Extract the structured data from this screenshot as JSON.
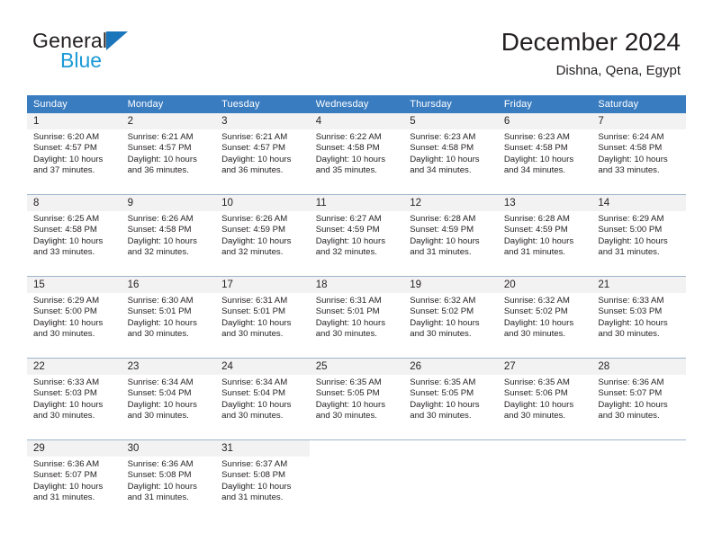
{
  "brand": {
    "name_part1": "General",
    "name_part2": "Blue",
    "triangle_color": "#1b75bb",
    "blue_text_color": "#1b9ad6"
  },
  "header": {
    "title": "December 2024",
    "subtitle": "Dishna, Qena, Egypt"
  },
  "theme": {
    "header_bg": "#3a7cc0",
    "header_text": "#ffffff",
    "daynum_band_bg": "#f2f2f2",
    "cell_border": "#9fb6cd",
    "text": "#231f20"
  },
  "weekday_headers": [
    "Sunday",
    "Monday",
    "Tuesday",
    "Wednesday",
    "Thursday",
    "Friday",
    "Saturday"
  ],
  "weeks": [
    [
      {
        "day": "1",
        "sunrise": "Sunrise: 6:20 AM",
        "sunset": "Sunset: 4:57 PM",
        "daylight1": "Daylight: 10 hours",
        "daylight2": "and 37 minutes."
      },
      {
        "day": "2",
        "sunrise": "Sunrise: 6:21 AM",
        "sunset": "Sunset: 4:57 PM",
        "daylight1": "Daylight: 10 hours",
        "daylight2": "and 36 minutes."
      },
      {
        "day": "3",
        "sunrise": "Sunrise: 6:21 AM",
        "sunset": "Sunset: 4:57 PM",
        "daylight1": "Daylight: 10 hours",
        "daylight2": "and 36 minutes."
      },
      {
        "day": "4",
        "sunrise": "Sunrise: 6:22 AM",
        "sunset": "Sunset: 4:58 PM",
        "daylight1": "Daylight: 10 hours",
        "daylight2": "and 35 minutes."
      },
      {
        "day": "5",
        "sunrise": "Sunrise: 6:23 AM",
        "sunset": "Sunset: 4:58 PM",
        "daylight1": "Daylight: 10 hours",
        "daylight2": "and 34 minutes."
      },
      {
        "day": "6",
        "sunrise": "Sunrise: 6:23 AM",
        "sunset": "Sunset: 4:58 PM",
        "daylight1": "Daylight: 10 hours",
        "daylight2": "and 34 minutes."
      },
      {
        "day": "7",
        "sunrise": "Sunrise: 6:24 AM",
        "sunset": "Sunset: 4:58 PM",
        "daylight1": "Daylight: 10 hours",
        "daylight2": "and 33 minutes."
      }
    ],
    [
      {
        "day": "8",
        "sunrise": "Sunrise: 6:25 AM",
        "sunset": "Sunset: 4:58 PM",
        "daylight1": "Daylight: 10 hours",
        "daylight2": "and 33 minutes."
      },
      {
        "day": "9",
        "sunrise": "Sunrise: 6:26 AM",
        "sunset": "Sunset: 4:58 PM",
        "daylight1": "Daylight: 10 hours",
        "daylight2": "and 32 minutes."
      },
      {
        "day": "10",
        "sunrise": "Sunrise: 6:26 AM",
        "sunset": "Sunset: 4:59 PM",
        "daylight1": "Daylight: 10 hours",
        "daylight2": "and 32 minutes."
      },
      {
        "day": "11",
        "sunrise": "Sunrise: 6:27 AM",
        "sunset": "Sunset: 4:59 PM",
        "daylight1": "Daylight: 10 hours",
        "daylight2": "and 32 minutes."
      },
      {
        "day": "12",
        "sunrise": "Sunrise: 6:28 AM",
        "sunset": "Sunset: 4:59 PM",
        "daylight1": "Daylight: 10 hours",
        "daylight2": "and 31 minutes."
      },
      {
        "day": "13",
        "sunrise": "Sunrise: 6:28 AM",
        "sunset": "Sunset: 4:59 PM",
        "daylight1": "Daylight: 10 hours",
        "daylight2": "and 31 minutes."
      },
      {
        "day": "14",
        "sunrise": "Sunrise: 6:29 AM",
        "sunset": "Sunset: 5:00 PM",
        "daylight1": "Daylight: 10 hours",
        "daylight2": "and 31 minutes."
      }
    ],
    [
      {
        "day": "15",
        "sunrise": "Sunrise: 6:29 AM",
        "sunset": "Sunset: 5:00 PM",
        "daylight1": "Daylight: 10 hours",
        "daylight2": "and 30 minutes."
      },
      {
        "day": "16",
        "sunrise": "Sunrise: 6:30 AM",
        "sunset": "Sunset: 5:01 PM",
        "daylight1": "Daylight: 10 hours",
        "daylight2": "and 30 minutes."
      },
      {
        "day": "17",
        "sunrise": "Sunrise: 6:31 AM",
        "sunset": "Sunset: 5:01 PM",
        "daylight1": "Daylight: 10 hours",
        "daylight2": "and 30 minutes."
      },
      {
        "day": "18",
        "sunrise": "Sunrise: 6:31 AM",
        "sunset": "Sunset: 5:01 PM",
        "daylight1": "Daylight: 10 hours",
        "daylight2": "and 30 minutes."
      },
      {
        "day": "19",
        "sunrise": "Sunrise: 6:32 AM",
        "sunset": "Sunset: 5:02 PM",
        "daylight1": "Daylight: 10 hours",
        "daylight2": "and 30 minutes."
      },
      {
        "day": "20",
        "sunrise": "Sunrise: 6:32 AM",
        "sunset": "Sunset: 5:02 PM",
        "daylight1": "Daylight: 10 hours",
        "daylight2": "and 30 minutes."
      },
      {
        "day": "21",
        "sunrise": "Sunrise: 6:33 AM",
        "sunset": "Sunset: 5:03 PM",
        "daylight1": "Daylight: 10 hours",
        "daylight2": "and 30 minutes."
      }
    ],
    [
      {
        "day": "22",
        "sunrise": "Sunrise: 6:33 AM",
        "sunset": "Sunset: 5:03 PM",
        "daylight1": "Daylight: 10 hours",
        "daylight2": "and 30 minutes."
      },
      {
        "day": "23",
        "sunrise": "Sunrise: 6:34 AM",
        "sunset": "Sunset: 5:04 PM",
        "daylight1": "Daylight: 10 hours",
        "daylight2": "and 30 minutes."
      },
      {
        "day": "24",
        "sunrise": "Sunrise: 6:34 AM",
        "sunset": "Sunset: 5:04 PM",
        "daylight1": "Daylight: 10 hours",
        "daylight2": "and 30 minutes."
      },
      {
        "day": "25",
        "sunrise": "Sunrise: 6:35 AM",
        "sunset": "Sunset: 5:05 PM",
        "daylight1": "Daylight: 10 hours",
        "daylight2": "and 30 minutes."
      },
      {
        "day": "26",
        "sunrise": "Sunrise: 6:35 AM",
        "sunset": "Sunset: 5:05 PM",
        "daylight1": "Daylight: 10 hours",
        "daylight2": "and 30 minutes."
      },
      {
        "day": "27",
        "sunrise": "Sunrise: 6:35 AM",
        "sunset": "Sunset: 5:06 PM",
        "daylight1": "Daylight: 10 hours",
        "daylight2": "and 30 minutes."
      },
      {
        "day": "28",
        "sunrise": "Sunrise: 6:36 AM",
        "sunset": "Sunset: 5:07 PM",
        "daylight1": "Daylight: 10 hours",
        "daylight2": "and 30 minutes."
      }
    ],
    [
      {
        "day": "29",
        "sunrise": "Sunrise: 6:36 AM",
        "sunset": "Sunset: 5:07 PM",
        "daylight1": "Daylight: 10 hours",
        "daylight2": "and 31 minutes."
      },
      {
        "day": "30",
        "sunrise": "Sunrise: 6:36 AM",
        "sunset": "Sunset: 5:08 PM",
        "daylight1": "Daylight: 10 hours",
        "daylight2": "and 31 minutes."
      },
      {
        "day": "31",
        "sunrise": "Sunrise: 6:37 AM",
        "sunset": "Sunset: 5:08 PM",
        "daylight1": "Daylight: 10 hours",
        "daylight2": "and 31 minutes."
      },
      {
        "day": "",
        "sunrise": "",
        "sunset": "",
        "daylight1": "",
        "daylight2": ""
      },
      {
        "day": "",
        "sunrise": "",
        "sunset": "",
        "daylight1": "",
        "daylight2": ""
      },
      {
        "day": "",
        "sunrise": "",
        "sunset": "",
        "daylight1": "",
        "daylight2": ""
      },
      {
        "day": "",
        "sunrise": "",
        "sunset": "",
        "daylight1": "",
        "daylight2": ""
      }
    ]
  ]
}
